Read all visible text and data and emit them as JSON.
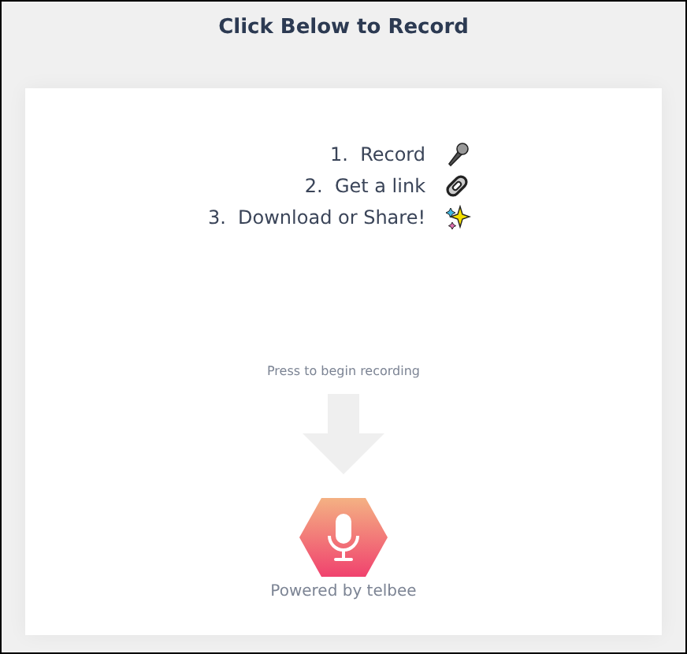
{
  "header": {
    "title": "Click Below to Record"
  },
  "steps": [
    {
      "number": "1.",
      "label": "Record",
      "kind": "mic"
    },
    {
      "number": "2.",
      "label": "Get a link",
      "kind": "link"
    },
    {
      "number": "3.",
      "label": "Download or Share!",
      "kind": "sparkle"
    }
  ],
  "hint": "Press to begin recording",
  "footer": "Powered by telbee"
}
